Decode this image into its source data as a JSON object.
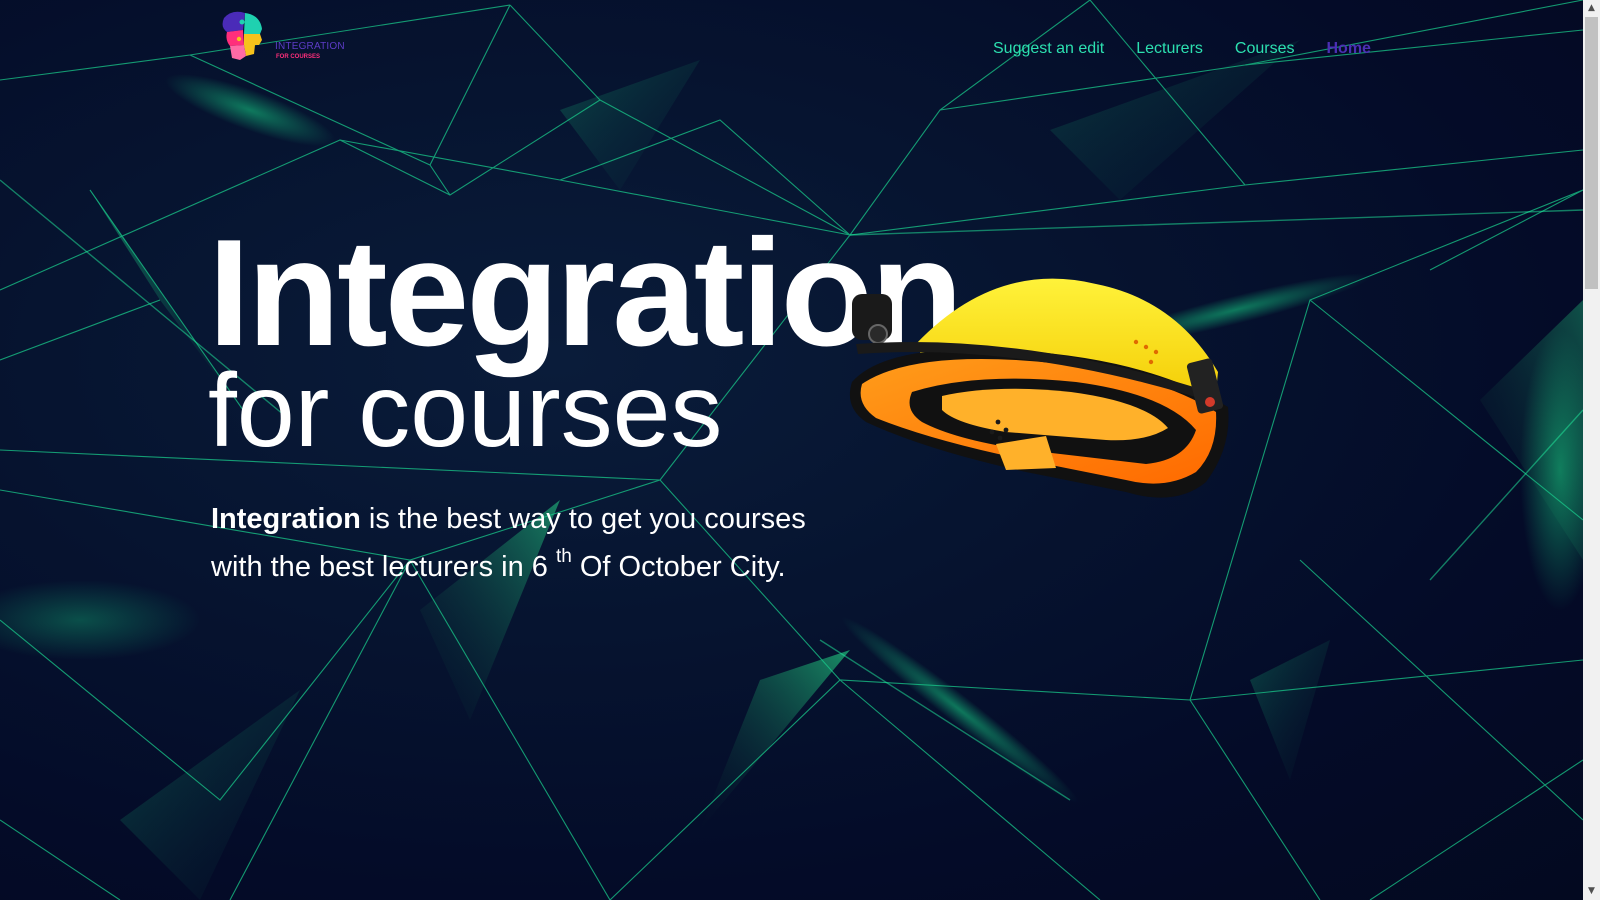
{
  "brand": {
    "name": "INTEGRATION",
    "tagline": "FOR COURSES"
  },
  "nav": {
    "items": [
      {
        "label": "Suggest an edit"
      },
      {
        "label": "Lecturers"
      },
      {
        "label": "Courses"
      },
      {
        "label": "Home"
      }
    ],
    "active": "Home"
  },
  "hero": {
    "title": "Integration",
    "subtitle": "for courses",
    "desc_bold": "Integration",
    "desc_text_1": " is the best way to get you courses with the best lecturers in 6 ",
    "desc_sup": "th",
    "desc_text_2": " Of October City."
  },
  "icons": {
    "logo": "puzzle-head-logo-icon",
    "helmet": "safety-helmet-icon",
    "scroll_up": "chevron-up-icon",
    "scroll_down": "chevron-down-icon"
  },
  "colors": {
    "background": "#040b28",
    "accent_green": "#2ce0b0",
    "nav_active": "#4b2fb4",
    "text": "#ffffff",
    "brand_purple": "#5d3cc7",
    "brand_pink": "#ff2e7b"
  }
}
